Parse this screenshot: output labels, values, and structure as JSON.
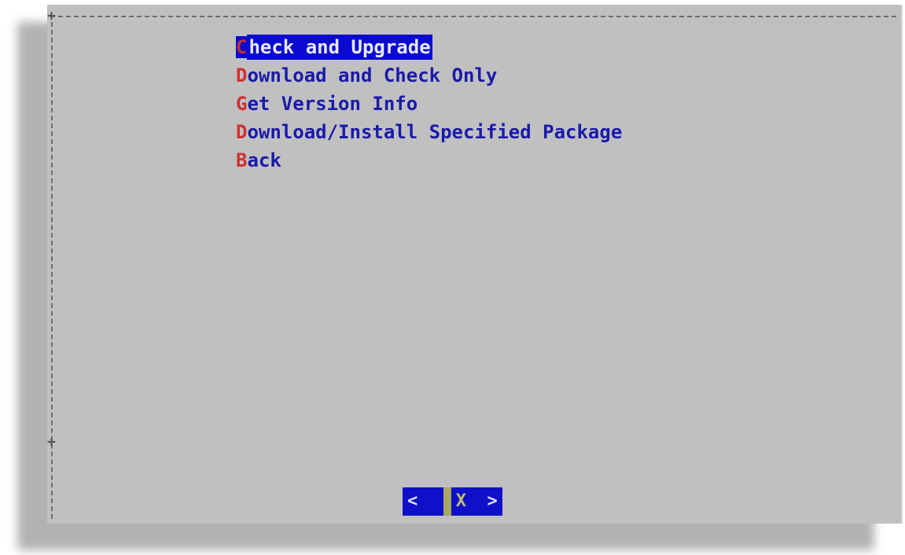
{
  "menu": {
    "items": [
      {
        "hotkey": "C",
        "rest": "heck and Upgrade",
        "selected": true
      },
      {
        "hotkey": "D",
        "rest": "ownload and Check Only",
        "selected": false
      },
      {
        "hotkey": "G",
        "rest": "et Version Info",
        "selected": false
      },
      {
        "hotkey": "D",
        "rest": "ownload/Install Specified Package",
        "selected": false
      },
      {
        "hotkey": "B",
        "rest": "ack",
        "selected": false
      }
    ]
  },
  "buttons": {
    "left": "<  ",
    "right_hotkey": "X",
    "right_rest": "  >"
  },
  "colors": {
    "dialog_bg": "#c0c0c0",
    "menu_text": "#1a1aa8",
    "hotkey": "#d03030",
    "selection_bg": "#0a0ad0"
  }
}
